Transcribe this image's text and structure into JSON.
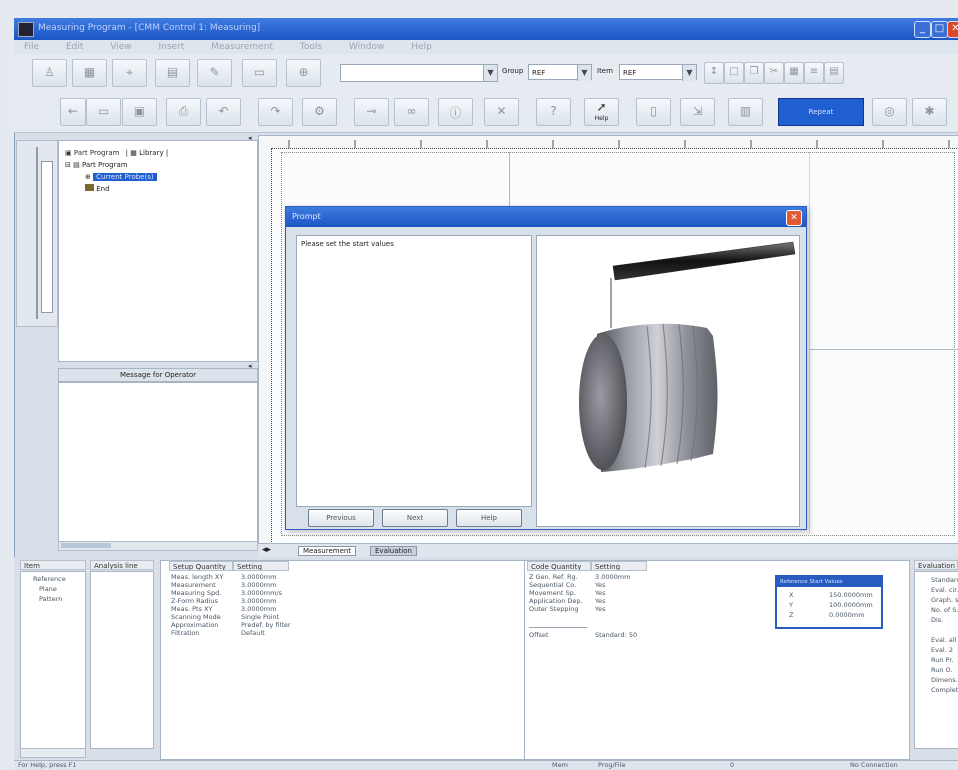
{
  "window": {
    "title": "Measuring Program - [CMM Control 1: Measuring]",
    "minimize_glyph": "_",
    "maximize_glyph": "□",
    "close_glyph": "✕"
  },
  "menubar": {
    "items": [
      "File",
      "Edit",
      "View",
      "Insert",
      "Measurement",
      "Tools",
      "Window",
      "Help"
    ]
  },
  "toolbar_top": {
    "combo_main_value": "",
    "label_group": "Group",
    "combo_group_value": "REF",
    "label_item": "Item",
    "combo_item_value": "REF"
  },
  "toolbar_bottom": {
    "help_label": "Help",
    "primary_button_label": "Repeat"
  },
  "tree": {
    "root_label": "Part Program",
    "tab_library_label": "Library",
    "program_node_label": "Part Program",
    "selected_node_label": "Current Probe(s)",
    "end_node_label": "End"
  },
  "message_panel": {
    "title": "Message for Operator"
  },
  "canvas_tabs": {
    "tab1": "Measurement",
    "tab2": "Evaluation"
  },
  "dialog": {
    "title": "Prompt",
    "message": "Please set the start values",
    "buttons": {
      "back": "Previous",
      "next": "Next",
      "help": "Help"
    }
  },
  "bottom": {
    "panel1": {
      "header": "Item",
      "items": [
        "Reference",
        "Plane",
        "Pattern"
      ]
    },
    "panel2": {
      "header": "Analysis line"
    },
    "setup": {
      "headers": [
        "Setup Quantity",
        "Setting"
      ],
      "rows": [
        [
          "Meas. length XY",
          "3.0000mm"
        ],
        [
          "Measurement",
          "3.0000mm"
        ],
        [
          "Measuring Spd.",
          "3.0000mm/s"
        ],
        [
          "Z-Form Radius",
          "3.0000mm"
        ],
        [
          "Meas. Pts XY",
          "3.0000mm"
        ],
        [
          "Scanning Mode",
          "Single Point"
        ],
        [
          "Approximation",
          "Predef. by filter"
        ],
        [
          "Filtration",
          "Default"
        ]
      ]
    },
    "code": {
      "headers": [
        "Code Quantity",
        "Setting"
      ],
      "rows": [
        [
          "Z Gen. Ref. Rg.",
          "3.0000mm"
        ],
        [
          "Sequential Co.",
          "Yes"
        ],
        [
          "Movement Sp.",
          "Yes"
        ],
        [
          "Application Dep.",
          "Yes"
        ],
        [
          "Outer Stepping",
          "Yes"
        ]
      ],
      "extra": [
        "Offset",
        "Standard: 50"
      ]
    },
    "mini_table": {
      "title": "Reference Start Values",
      "rows": [
        [
          "X",
          "150.0000mm"
        ],
        [
          "Y",
          "100.0000mm"
        ],
        [
          "Z",
          "0.0000mm"
        ]
      ]
    },
    "right_panel": {
      "header": "Evaluation Settings",
      "rows": [
        "Standard",
        "Eval. cir.",
        "Graph. s.",
        "No. of S.",
        "Dis.",
        "Eval. all",
        "Eval. 2",
        "Run Pr.",
        "Run O.",
        "Dimens.",
        "Complete"
      ]
    }
  },
  "statusbar": {
    "left": "For Help, press F1",
    "mid1": "Mem",
    "mid2": "Prog/File",
    "mid3": "0",
    "right": "No Connection"
  },
  "colors": {
    "title_blue": "#1c55c4",
    "selection_blue": "#1f5fd0",
    "panel_bg": "#d8dfe8"
  }
}
